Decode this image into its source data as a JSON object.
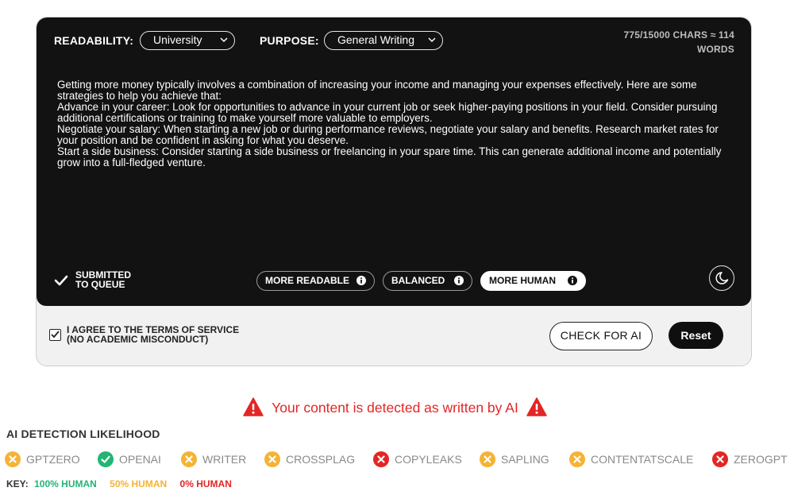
{
  "header": {
    "readability_label": "READABILITY:",
    "readability_value": "University",
    "purpose_label": "PURPOSE:",
    "purpose_value": "General Writing",
    "counter_line1": "775/15000 CHARS ≈ 114",
    "counter_line2": "WORDS"
  },
  "text": {
    "lines": [
      "Getting more money typically involves a combination of increasing your income and managing your expenses effectively. Here are some strategies to help you achieve that:",
      "Advance in your career: Look for opportunities to advance in your current job or seek higher-paying positions in your field. Consider pursuing additional certifications or training to make yourself more valuable to employers.",
      "Negotiate your salary: When starting a new job or during performance reviews, negotiate your salary and benefits. Research market rates for your position and be confident in asking for what you deserve.",
      "Start a side business: Consider starting a side business or freelancing in your spare time. This can generate additional income and potentially grow into a full-fledged venture."
    ]
  },
  "status": {
    "submitted_line1": "SUBMITTED",
    "submitted_line2": "TO QUEUE"
  },
  "modes": [
    {
      "label": "MORE READABLE",
      "active": false
    },
    {
      "label": "BALANCED",
      "active": false
    },
    {
      "label": "MORE HUMAN",
      "active": true
    }
  ],
  "footer": {
    "agree_line1": "I AGREE TO THE TERMS OF SERVICE",
    "agree_line2": "(NO ACADEMIC MISCONDUCT)",
    "check_button": "CHECK FOR AI",
    "reset_button": "Reset"
  },
  "alert": {
    "message": "Your content is detected as written by AI",
    "color": "#e42525"
  },
  "detection": {
    "title": "AI DETECTION LIKELIHOOD",
    "detectors": [
      {
        "name": "GPTZERO",
        "status": "partial"
      },
      {
        "name": "OPENAI",
        "status": "human"
      },
      {
        "name": "WRITER",
        "status": "partial"
      },
      {
        "name": "CROSSPLAG",
        "status": "partial"
      },
      {
        "name": "COPYLEAKS",
        "status": "ai"
      },
      {
        "name": "SAPLING",
        "status": "partial"
      },
      {
        "name": "CONTENTATSCALE",
        "status": "partial"
      },
      {
        "name": "ZEROGPT",
        "status": "ai"
      }
    ],
    "key_label": "KEY:",
    "key_human": "100% HUMAN",
    "key_partial": "50% HUMAN",
    "key_ai": "0% HUMAN",
    "colors": {
      "human": "#22b573",
      "partial": "#f5b335",
      "ai": "#e42525"
    }
  }
}
